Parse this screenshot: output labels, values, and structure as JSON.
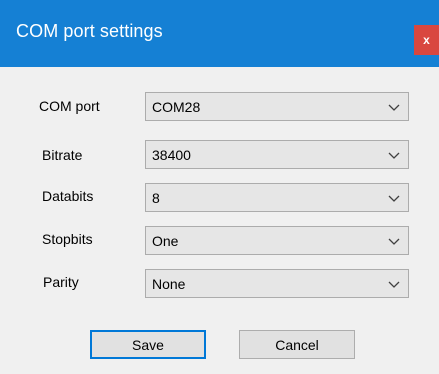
{
  "window": {
    "title": "COM port settings",
    "close_label": "x"
  },
  "form": {
    "rows": [
      {
        "label": "COM port",
        "value": "COM28"
      },
      {
        "label": "Bitrate",
        "value": "38400"
      },
      {
        "label": "Databits",
        "value": "8"
      },
      {
        "label": "Stopbits",
        "value": "One"
      },
      {
        "label": "Parity",
        "value": "None"
      }
    ]
  },
  "buttons": {
    "save_label": "Save",
    "cancel_label": "Cancel"
  },
  "icons": {
    "dropdown": "chevron-down-icon",
    "close": "close-icon"
  },
  "colors": {
    "titlebar": "#1580d4",
    "close": "#d9473f",
    "focus": "#0078d7"
  }
}
